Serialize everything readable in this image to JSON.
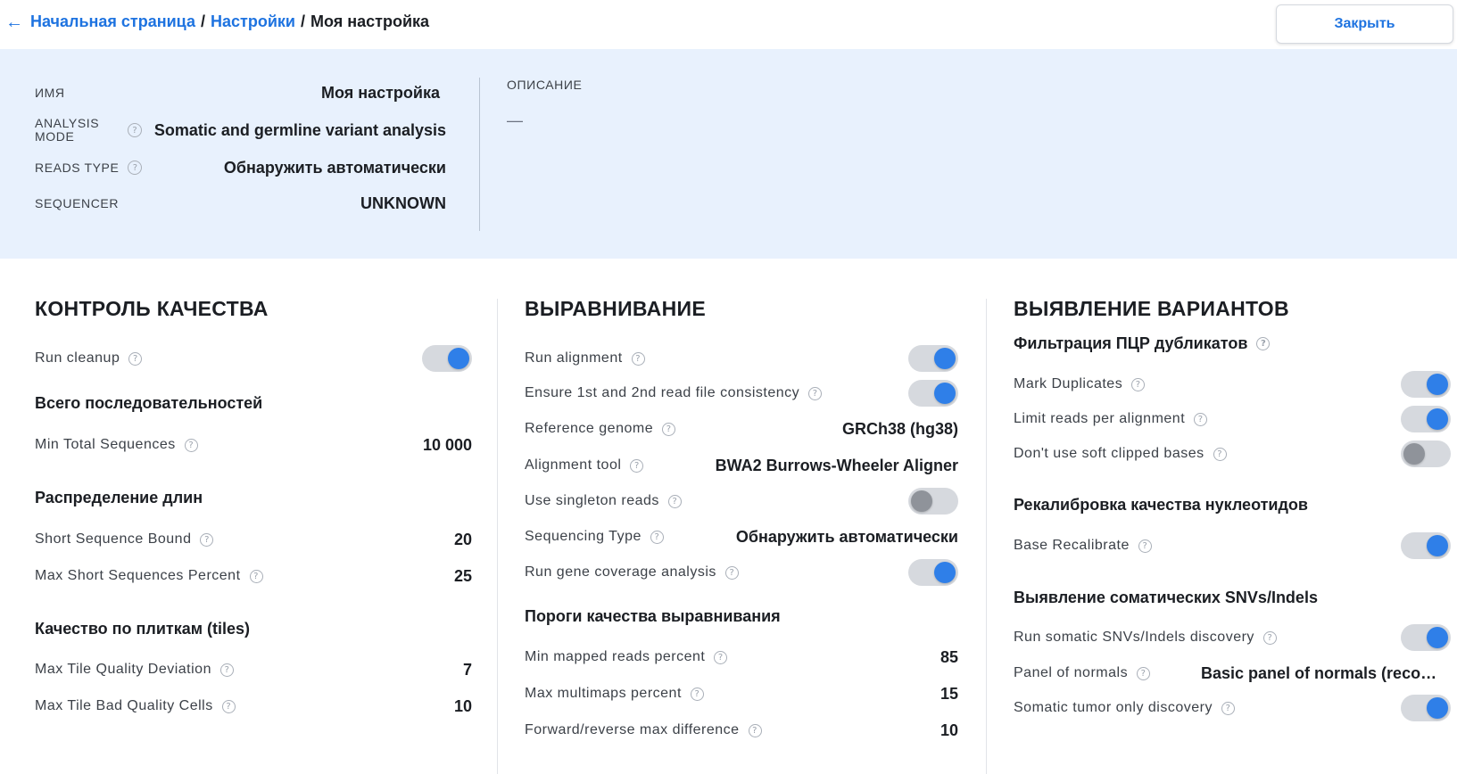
{
  "breadcrumb": {
    "home": "Начальная страница",
    "settings": "Настройки",
    "current": "Моя настройка",
    "separator": "/"
  },
  "close_button": "Закрыть",
  "info": {
    "name_label": "ИМЯ",
    "name_value": "Моя настройка",
    "mode_label": "ANALYSIS MODE",
    "mode_value": "Somatic and germline variant analysis",
    "reads_label": "READS TYPE",
    "reads_value": "Обнаружить автоматически",
    "sequencer_label": "SEQUENCER",
    "sequencer_value": "UNKNOWN",
    "description_label": "ОПИСАНИЕ",
    "description_value": "—"
  },
  "qc": {
    "title": "КОНТРОЛЬ КАЧЕСТВА",
    "run_cleanup": {
      "label": "Run cleanup",
      "enabled": true
    },
    "total_sequences": {
      "title": "Всего последовательностей",
      "min_label": "Min Total Sequences",
      "min_value": "10 000"
    },
    "length_distribution": {
      "title": "Распределение длин",
      "short_bound_label": "Short Sequence Bound",
      "short_bound_value": "20",
      "max_short_label": "Max Short Sequences Percent",
      "max_short_value": "25"
    },
    "tiles": {
      "title": "Качество по плиткам (tiles)",
      "deviation_label": "Max Tile Quality Deviation",
      "deviation_value": "7",
      "bad_cells_label": "Max Tile Bad Quality Cells",
      "bad_cells_value": "10"
    }
  },
  "alignment": {
    "title": "ВЫРАВНИВАНИЕ",
    "run_alignment": {
      "label": "Run alignment",
      "enabled": true
    },
    "consistency": {
      "label": "Ensure 1st and 2nd read file consistency",
      "enabled": true
    },
    "reference_label": "Reference genome",
    "reference_value": "GRCh38 (hg38)",
    "tool_label": "Alignment tool",
    "tool_value": "BWA2 Burrows-Wheeler Aligner",
    "singleton": {
      "label": "Use singleton reads",
      "enabled": false
    },
    "seq_type_label": "Sequencing Type",
    "seq_type_value": "Обнаружить автоматически",
    "gene_coverage": {
      "label": "Run gene coverage analysis",
      "enabled": true
    },
    "thresholds": {
      "title": "Пороги качества выравнивания",
      "mapped_label": "Min mapped reads percent",
      "mapped_value": "85",
      "multimaps_label": "Max multimaps percent",
      "multimaps_value": "15",
      "fr_label": "Forward/reverse max difference",
      "fr_value": "10"
    }
  },
  "variants": {
    "title": "ВЫЯВЛЕНИЕ ВАРИАНТОВ",
    "pcr": {
      "title": "Фильтрация ПЦР дубликатов",
      "mark_duplicates": {
        "label": "Mark Duplicates",
        "enabled": true
      },
      "limit_reads": {
        "label": "Limit reads per alignment",
        "enabled": true
      },
      "soft_clipped": {
        "label": "Don't use soft clipped bases",
        "enabled": false
      }
    },
    "recalibration": {
      "title": "Рекалибровка качества нуклеотидов",
      "base_recalibrate": {
        "label": "Base Recalibrate",
        "enabled": true
      }
    },
    "somatic": {
      "title": "Выявление соматических SNVs/Indels",
      "run_discovery": {
        "label": "Run somatic SNVs/Indels discovery",
        "enabled": true
      },
      "panel_label": "Panel of normals",
      "panel_value": "Basic panel of normals (recome...",
      "tumor_only": {
        "label": "Somatic tumor only discovery",
        "enabled": true
      }
    }
  },
  "colors": {
    "accent": "#2f7fe8",
    "link": "#1e73e0",
    "info_bg": "#e8f1fd",
    "toggle_off": "#8f939a"
  }
}
